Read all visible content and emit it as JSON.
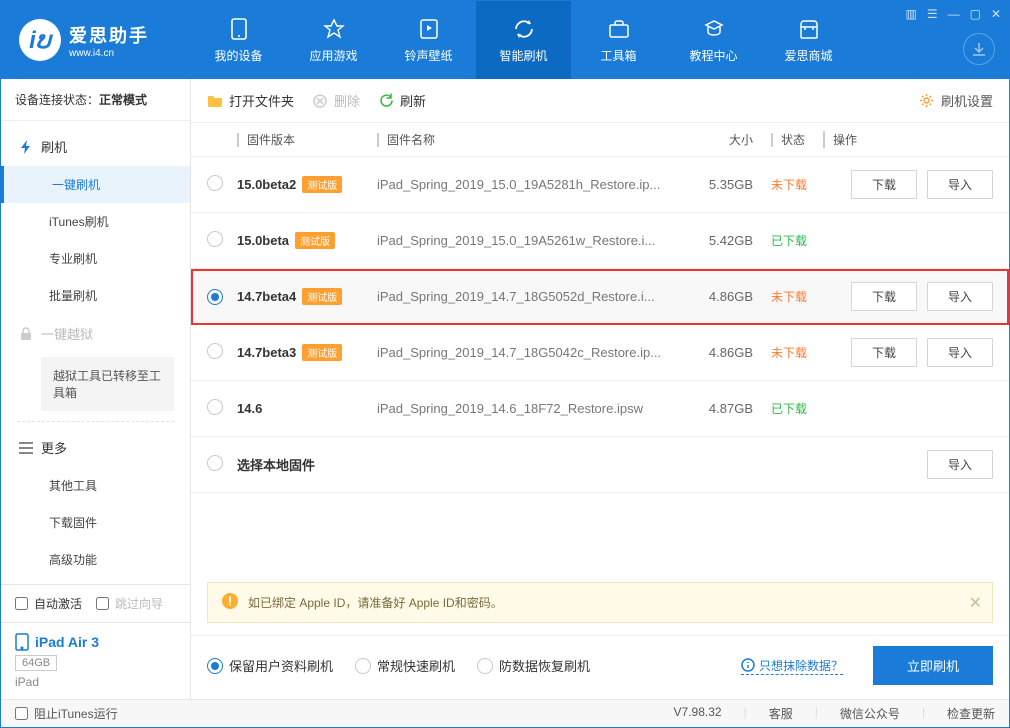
{
  "app": {
    "name": "爱思助手",
    "tagline": "www.i4.cn"
  },
  "nav": [
    {
      "key": "device",
      "label": "我的设备"
    },
    {
      "key": "apps",
      "label": "应用游戏"
    },
    {
      "key": "rings",
      "label": "铃声壁纸"
    },
    {
      "key": "flash",
      "label": "智能刷机"
    },
    {
      "key": "tools",
      "label": "工具箱"
    },
    {
      "key": "tut",
      "label": "教程中心"
    },
    {
      "key": "mall",
      "label": "爱思商城"
    }
  ],
  "status": {
    "label": "设备连接状态：",
    "value": "正常模式"
  },
  "sidebar": {
    "flash": {
      "title": "刷机",
      "items": [
        "一键刷机",
        "iTunes刷机",
        "专业刷机",
        "批量刷机"
      ]
    },
    "jb": {
      "title": "一键越狱",
      "notice": "越狱工具已转移至工具箱"
    },
    "more": {
      "title": "更多",
      "items": [
        "其他工具",
        "下载固件",
        "高级功能"
      ]
    }
  },
  "side_bottom": {
    "auto_activate": "自动激活",
    "skip_guide": "跳过向导"
  },
  "device": {
    "name": "iPad Air 3",
    "cap": "64GB",
    "type": "iPad"
  },
  "toolbar": {
    "open": "打开文件夹",
    "delete": "删除",
    "refresh": "刷新",
    "settings": "刷机设置"
  },
  "columns": {
    "ver": "固件版本",
    "name": "固件名称",
    "size": "大小",
    "status": "状态",
    "ops": "操作"
  },
  "ops": {
    "download": "下载",
    "import": "导入"
  },
  "status_text": {
    "undownloaded": "未下载",
    "downloaded": "已下载"
  },
  "rows": [
    {
      "ver": "15.0beta2",
      "badge": "测试版",
      "name": "iPad_Spring_2019_15.0_19A5281h_Restore.ip...",
      "size": "5.35GB",
      "status": "undownloaded",
      "selected": false,
      "dl": true,
      "imp": true,
      "hl": false
    },
    {
      "ver": "15.0beta",
      "badge": "测试版",
      "name": "iPad_Spring_2019_15.0_19A5261w_Restore.i...",
      "size": "5.42GB",
      "status": "downloaded",
      "selected": false,
      "dl": false,
      "imp": false,
      "hl": false
    },
    {
      "ver": "14.7beta4",
      "badge": "测试版",
      "name": "iPad_Spring_2019_14.7_18G5052d_Restore.i...",
      "size": "4.86GB",
      "status": "undownloaded",
      "selected": true,
      "dl": true,
      "imp": true,
      "hl": true
    },
    {
      "ver": "14.7beta3",
      "badge": "测试版",
      "name": "iPad_Spring_2019_14.7_18G5042c_Restore.ip...",
      "size": "4.86GB",
      "status": "undownloaded",
      "selected": false,
      "dl": true,
      "imp": true,
      "hl": false
    },
    {
      "ver": "14.6",
      "badge": "",
      "name": "iPad_Spring_2019_14.6_18F72_Restore.ipsw",
      "size": "4.87GB",
      "status": "downloaded",
      "selected": false,
      "dl": false,
      "imp": false,
      "hl": false
    },
    {
      "ver": "选择本地固件",
      "badge": "",
      "name": "",
      "size": "",
      "status": "",
      "selected": false,
      "dl": false,
      "imp": true,
      "hl": false
    }
  ],
  "banner": "如已绑定 Apple ID，请准备好 Apple ID和密码。",
  "options": {
    "o1": "保留用户资料刷机",
    "o2": "常规快速刷机",
    "o3": "防数据恢复刷机"
  },
  "action": {
    "wipe_link": "只想抹除数据？",
    "flash_btn": "立即刷机"
  },
  "footer": {
    "block": "阻止iTunes运行",
    "ver": "V7.98.32",
    "cs": "客服",
    "wx": "微信公众号",
    "upd": "检查更新"
  }
}
